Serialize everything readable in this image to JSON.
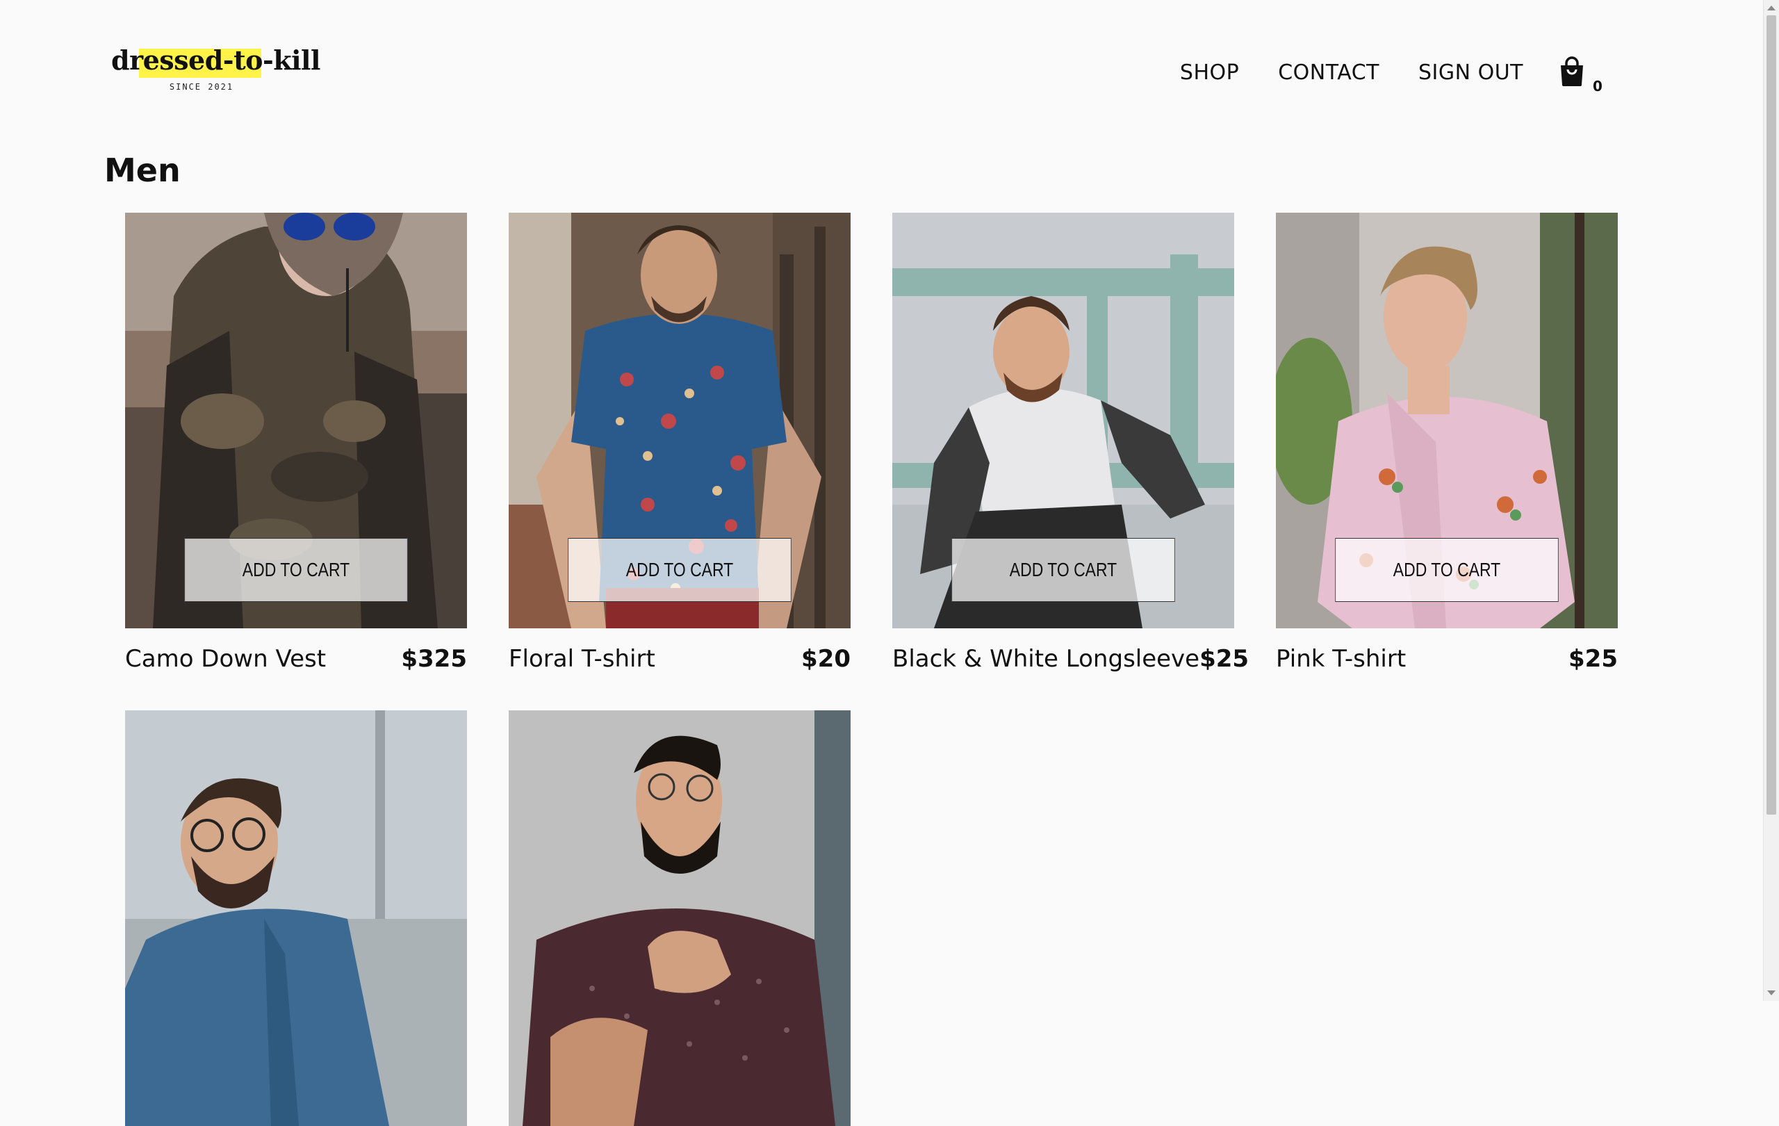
{
  "header": {
    "logo": {
      "prefix": "dr",
      "highlight": "essed-to-k",
      "suffix": "ill",
      "tagline": "SINCE 2021",
      "highlight_color": "#fff34a"
    },
    "nav": [
      {
        "label": "SHOP"
      },
      {
        "label": "CONTACT"
      },
      {
        "label": "SIGN OUT"
      }
    ],
    "cart": {
      "icon": "shopping-bag-icon",
      "count": "0"
    }
  },
  "category": {
    "title": "Men"
  },
  "products": [
    {
      "name": "Camo Down Vest",
      "price": "$325",
      "button": "ADD TO CART",
      "image": "camo-vest-photo"
    },
    {
      "name": "Floral T-shirt",
      "price": "$20",
      "button": "ADD TO CART",
      "image": "floral-shirt-photo"
    },
    {
      "name": "Black & White Longsleeve",
      "price": "$25",
      "button": "ADD TO CART",
      "image": "raglan-longsleeve-photo"
    },
    {
      "name": "Pink T-shirt",
      "price": "$25",
      "button": "ADD TO CART",
      "image": "pink-shirt-photo"
    },
    {
      "image": "denim-shirt-photo"
    },
    {
      "image": "dotted-shirt-photo"
    }
  ]
}
